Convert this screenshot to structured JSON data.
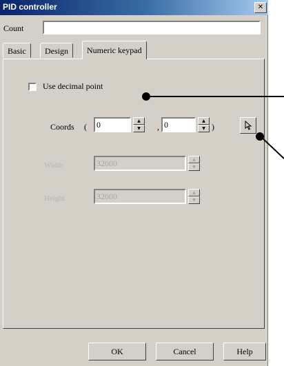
{
  "window": {
    "title": "PID controller",
    "close_glyph": "✕"
  },
  "count": {
    "label": "Count",
    "value": ""
  },
  "tabs": [
    {
      "label": "Basic",
      "active": false
    },
    {
      "label": "Design",
      "active": false
    },
    {
      "label": "Numeric keypad",
      "active": true
    }
  ],
  "keypad": {
    "use_decimal_point": {
      "label": "Use decimal point",
      "checked": false
    },
    "coords": {
      "label": "Coords",
      "open_paren": "(",
      "separator": ",",
      "close_paren": ")",
      "x_value": "0",
      "y_value": "0",
      "pick_icon": "pointer-pick-icon"
    },
    "dim_rows": [
      {
        "label": "Width",
        "value": "32000"
      },
      {
        "label": "Height",
        "value": "32000"
      }
    ]
  },
  "buttons": {
    "ok": "OK",
    "cancel": "Cancel",
    "help": "Help"
  },
  "colors": {
    "face": "#d4d0c8",
    "title_start": "#0a246a",
    "title_end": "#a6caf0",
    "disabled_text": "#a8a4a0"
  }
}
